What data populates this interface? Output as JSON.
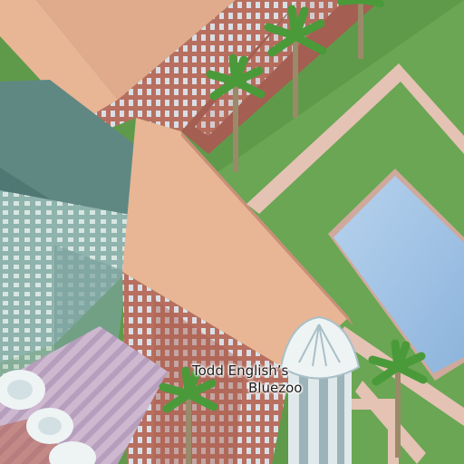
{
  "map": {
    "poi_label": {
      "line1": "Todd English’s",
      "line2": "Bluezoo"
    },
    "colors": {
      "lawn": "#5f9a4a",
      "roof_peach": "#e8b595",
      "brick": "#b86f5f",
      "teal_roof": "#5f8883",
      "pool_water": "#9fc3e3",
      "pool_deck": "#e4c2b4",
      "palm_green": "#4a9a3a",
      "plaza_lilac": "#c8b4cc",
      "shell_white": "#eef3f4"
    },
    "icons": [
      "palm-tree-icon",
      "shell-fountain-icon",
      "umbrella-icon"
    ]
  }
}
